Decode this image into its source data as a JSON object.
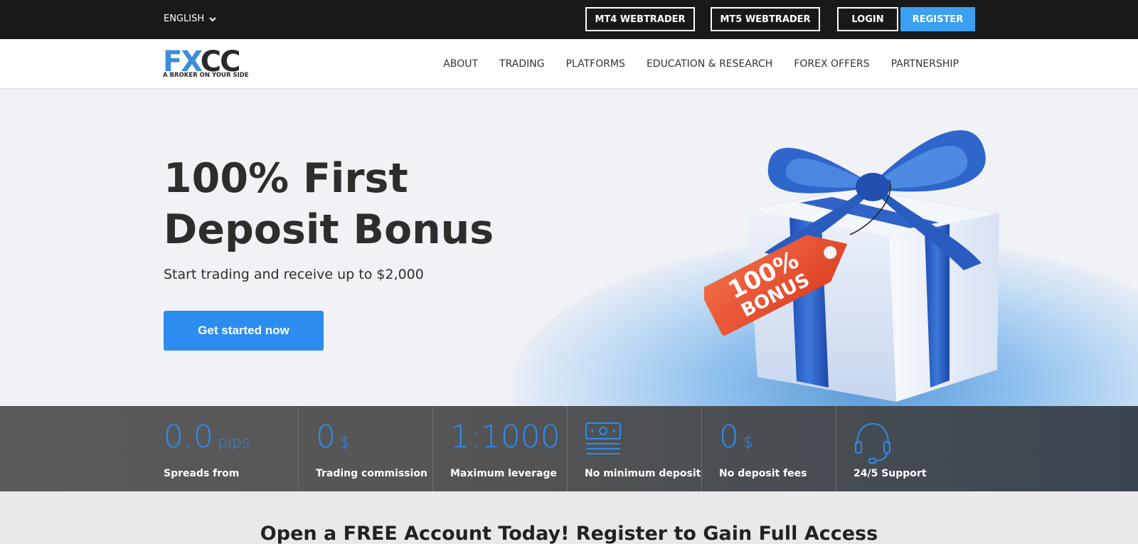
{
  "topbar": {
    "language": "ENGLISH",
    "mt4": "MT4 WEBTRADER",
    "mt5": "MT5 WEBTRADER",
    "login": "LOGIN",
    "register": "REGISTER"
  },
  "logo": {
    "letters": "FXCC",
    "tagline": "A BROKER ON YOUR SIDE"
  },
  "nav": [
    "ABOUT",
    "TRADING",
    "PLATFORMS",
    "EDUCATION & RESEARCH",
    "FOREX OFFERS",
    "PARTNERSHIP"
  ],
  "hero": {
    "title_line1": "100% First",
    "title_line2": "Deposit Bonus",
    "subtitle": "Start trading and receive up to $2,000",
    "cta": "Get started now",
    "tag_line1": "100%",
    "tag_line2": "BONUS"
  },
  "stats": [
    {
      "value": "0.0",
      "unit": "pips",
      "label": "Spreads from"
    },
    {
      "value": "0",
      "unit": "$",
      "label": "Trading commission"
    },
    {
      "value": "1:1000",
      "unit": "",
      "label": "Maximum leverage"
    },
    {
      "icon": "banknote-icon",
      "label": "No minimum deposit"
    },
    {
      "value": "0",
      "unit": "$",
      "label": "No deposit fees"
    },
    {
      "icon": "headset-icon",
      "label": "24/5 Support"
    }
  ],
  "bottom": {
    "pre": "Open a ",
    "bold": "FREE Account",
    "post": " Today! Register to Gain Full Access"
  },
  "colors": {
    "accent": "#2d8cf0",
    "register": "#3aa0f0",
    "topbar": "#191919",
    "tag": "#e8502e"
  }
}
